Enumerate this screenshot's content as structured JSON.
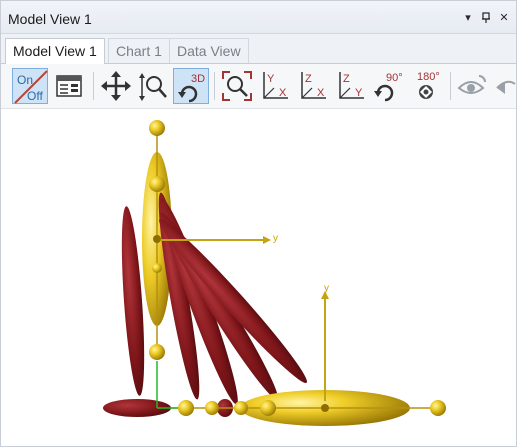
{
  "window": {
    "title": "Model View 1"
  },
  "title_controls": {
    "dropdown": "▾",
    "pin": "ᴾ",
    "close": "✕"
  },
  "tabs": [
    {
      "label": "Model View 1",
      "active": true
    },
    {
      "label": "Chart 1",
      "active": false
    },
    {
      "label": "Data View",
      "active": false
    }
  ],
  "toolbar": {
    "toggle_on_label": "On",
    "toggle_off_label": "Off",
    "rotate_3d_label": "3D",
    "axis_labels": {
      "yx_top": "Y",
      "yx_bottom": "X",
      "zx_top": "Z",
      "zx_bottom": "X",
      "zy_top": "Z",
      "zy_bottom": "Y"
    },
    "rotate_90_label": "90°",
    "rotate_180_label": "180°"
  },
  "viewport": {
    "axis_label_upper": "y",
    "axis_label_lower": "y",
    "colors": {
      "gold": "#e1ba1a",
      "maroon": "#7d1519",
      "axis": "#c8a311",
      "green": "#22bb22"
    }
  }
}
